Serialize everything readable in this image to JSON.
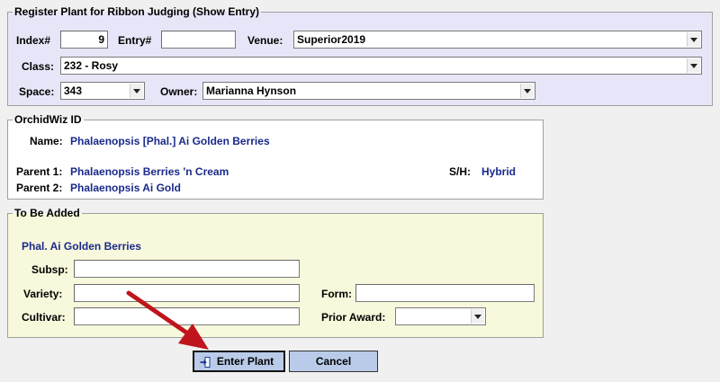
{
  "register": {
    "legend": "Register Plant for Ribbon Judging (Show Entry)",
    "index_label": "Index#",
    "index_value": "9",
    "entry_label": "Entry#",
    "entry_value": "",
    "venue_label": "Venue:",
    "venue_value": "Superior2019",
    "class_label": "Class:",
    "class_value": "232 - Rosy",
    "space_label": "Space:",
    "space_value": "343",
    "owner_label": "Owner:",
    "owner_value": "Marianna Hynson"
  },
  "orchidwiz": {
    "legend": "OrchidWiz ID",
    "name_label": "Name:",
    "name_value": "Phalaenopsis [Phal.] Ai Golden Berries",
    "parent1_label": "Parent 1:",
    "parent1_value": "Phalaenopsis Berries 'n Cream",
    "parent2_label": "Parent 2:",
    "parent2_value": "Phalaenopsis Ai Gold",
    "sh_label": "S/H:",
    "sh_value": "Hybrid"
  },
  "to_be_added": {
    "legend": "To Be Added",
    "plant_name": "Phal. Ai Golden Berries",
    "subsp_label": "Subsp:",
    "subsp_value": "",
    "variety_label": "Variety:",
    "variety_value": "",
    "cultivar_label": "Cultivar:",
    "cultivar_value": "",
    "form_label": "Form:",
    "form_value": "",
    "prior_award_label": "Prior Award:",
    "prior_award_value": ""
  },
  "buttons": {
    "enter_plant": "Enter Plant",
    "cancel": "Cancel"
  },
  "colors": {
    "register_bg": "#e6e6f8",
    "orchidwiz_bg": "#ffffff",
    "to_be_added_bg": "#f8f8dc",
    "value_text": "#1a2a8a",
    "button_bg": "#b9cbe8",
    "arrow": "#c0141c"
  },
  "icons": {
    "enter_plant_icon": "enter-arrow-icon",
    "annotation_arrow": "red-arrow-icon"
  }
}
